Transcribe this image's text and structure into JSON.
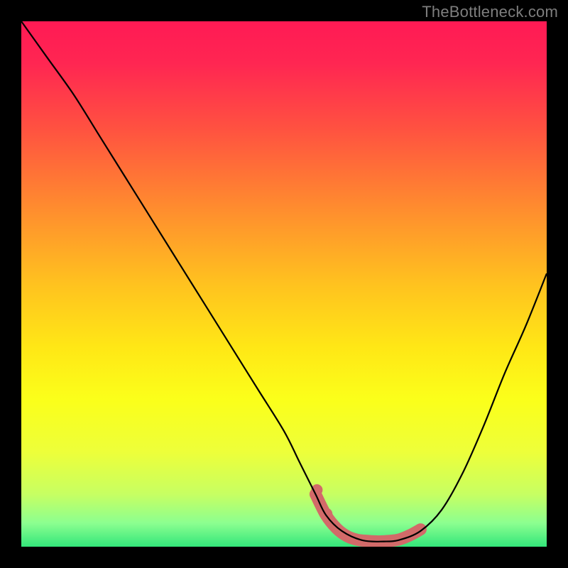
{
  "watermark": "TheBottleneck.com",
  "colors": {
    "frame": "#000000",
    "curve": "#000000",
    "marker": "#d26a69",
    "gradient_stops": [
      {
        "offset": 0.0,
        "color": "#ff1a54"
      },
      {
        "offset": 0.08,
        "color": "#ff2652"
      },
      {
        "offset": 0.2,
        "color": "#ff5041"
      },
      {
        "offset": 0.35,
        "color": "#ff8a2f"
      },
      {
        "offset": 0.5,
        "color": "#ffc21f"
      },
      {
        "offset": 0.62,
        "color": "#ffe716"
      },
      {
        "offset": 0.72,
        "color": "#fbff1a"
      },
      {
        "offset": 0.82,
        "color": "#edff3a"
      },
      {
        "offset": 0.9,
        "color": "#c7ff62"
      },
      {
        "offset": 0.955,
        "color": "#8cff90"
      },
      {
        "offset": 1.0,
        "color": "#33e67a"
      }
    ]
  },
  "chart_data": {
    "type": "line",
    "title": "",
    "xlabel": "",
    "ylabel": "",
    "xlim": [
      0,
      100
    ],
    "ylim": [
      0,
      100
    ],
    "grid": false,
    "legend": false,
    "series": [
      {
        "name": "bottleneck-curve",
        "x": [
          0,
          5,
          10,
          15,
          20,
          25,
          30,
          35,
          40,
          45,
          50,
          53,
          56,
          58,
          61,
          65,
          69,
          72,
          76,
          80,
          84,
          88,
          92,
          96,
          100
        ],
        "y": [
          100,
          93,
          86,
          78,
          70,
          62,
          54,
          46,
          38,
          30,
          22,
          16,
          10,
          6,
          3,
          1.2,
          1,
          1.3,
          3,
          7,
          14,
          23,
          33,
          42,
          52
        ]
      }
    ],
    "markers": {
      "name": "highlight-segment",
      "color": "#d26a69",
      "x": [
        56,
        58,
        60,
        62,
        64,
        66,
        68,
        70,
        72,
        74,
        76
      ],
      "y": [
        10,
        6,
        3.5,
        2,
        1.3,
        1.1,
        1.0,
        1.1,
        1.4,
        2.2,
        3.3
      ]
    }
  }
}
